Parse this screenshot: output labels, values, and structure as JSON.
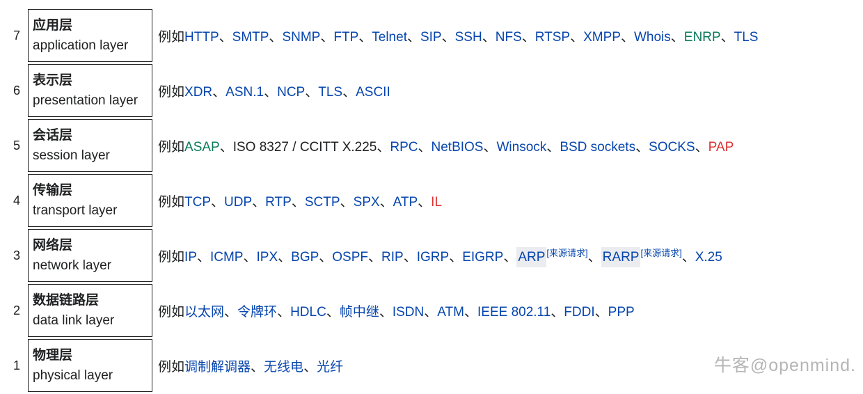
{
  "watermark": "牛客@openmind.",
  "prefix": "例如",
  "layers": [
    {
      "num": "7",
      "cn": "应用层",
      "en": "application layer",
      "items": [
        {
          "t": "HTTP",
          "s": "link"
        },
        {
          "t": "、",
          "s": "plain"
        },
        {
          "t": "SMTP",
          "s": "link"
        },
        {
          "t": "、",
          "s": "plain"
        },
        {
          "t": "SNMP",
          "s": "link"
        },
        {
          "t": "、",
          "s": "plain"
        },
        {
          "t": "FTP",
          "s": "link"
        },
        {
          "t": "、",
          "s": "plain"
        },
        {
          "t": "Telnet",
          "s": "link"
        },
        {
          "t": "、",
          "s": "plain"
        },
        {
          "t": "SIP",
          "s": "link"
        },
        {
          "t": "、",
          "s": "plain"
        },
        {
          "t": "SSH",
          "s": "link"
        },
        {
          "t": "、",
          "s": "plain"
        },
        {
          "t": "NFS",
          "s": "link"
        },
        {
          "t": "、",
          "s": "plain"
        },
        {
          "t": "RTSP",
          "s": "link"
        },
        {
          "t": "、",
          "s": "plain"
        },
        {
          "t": "XMPP",
          "s": "link"
        },
        {
          "t": "、",
          "s": "plain"
        },
        {
          "t": "Whois",
          "s": "link"
        },
        {
          "t": "、",
          "s": "plain"
        },
        {
          "t": "ENRP",
          "s": "ext"
        },
        {
          "t": "、",
          "s": "plain"
        },
        {
          "t": "TLS",
          "s": "link"
        }
      ]
    },
    {
      "num": "6",
      "cn": "表示层",
      "en": "presentation layer",
      "items": [
        {
          "t": "XDR",
          "s": "link"
        },
        {
          "t": "、",
          "s": "plain"
        },
        {
          "t": "ASN.1",
          "s": "link"
        },
        {
          "t": "、",
          "s": "plain"
        },
        {
          "t": "NCP",
          "s": "link"
        },
        {
          "t": "、",
          "s": "plain"
        },
        {
          "t": "TLS",
          "s": "link"
        },
        {
          "t": "、",
          "s": "plain"
        },
        {
          "t": "ASCII",
          "s": "link"
        }
      ]
    },
    {
      "num": "5",
      "cn": "会话层",
      "en": "session layer",
      "items": [
        {
          "t": "ASAP",
          "s": "ext"
        },
        {
          "t": "、ISO 8327 / CCITT X.225、",
          "s": "plain"
        },
        {
          "t": "RPC",
          "s": "link"
        },
        {
          "t": "、",
          "s": "plain"
        },
        {
          "t": "NetBIOS",
          "s": "link"
        },
        {
          "t": "、",
          "s": "plain"
        },
        {
          "t": "Winsock",
          "s": "link"
        },
        {
          "t": "、",
          "s": "plain"
        },
        {
          "t": "BSD sockets",
          "s": "link"
        },
        {
          "t": "、",
          "s": "plain"
        },
        {
          "t": "SOCKS",
          "s": "link"
        },
        {
          "t": "、",
          "s": "plain"
        },
        {
          "t": "PAP",
          "s": "new"
        }
      ]
    },
    {
      "num": "4",
      "cn": "传输层",
      "en": "transport layer",
      "items": [
        {
          "t": "TCP",
          "s": "link"
        },
        {
          "t": "、",
          "s": "plain"
        },
        {
          "t": "UDP",
          "s": "link"
        },
        {
          "t": "、",
          "s": "plain"
        },
        {
          "t": "RTP",
          "s": "link"
        },
        {
          "t": "、",
          "s": "plain"
        },
        {
          "t": "SCTP",
          "s": "link"
        },
        {
          "t": "、",
          "s": "plain"
        },
        {
          "t": "SPX",
          "s": "link"
        },
        {
          "t": "、",
          "s": "plain"
        },
        {
          "t": "ATP",
          "s": "link"
        },
        {
          "t": "、",
          "s": "plain"
        },
        {
          "t": "IL",
          "s": "new"
        }
      ]
    },
    {
      "num": "3",
      "cn": "网络层",
      "en": "network layer",
      "items": [
        {
          "t": "IP",
          "s": "link"
        },
        {
          "t": "、",
          "s": "plain"
        },
        {
          "t": "ICMP",
          "s": "link"
        },
        {
          "t": "、",
          "s": "plain"
        },
        {
          "t": "IPX",
          "s": "link"
        },
        {
          "t": "、",
          "s": "plain"
        },
        {
          "t": "BGP",
          "s": "link"
        },
        {
          "t": "、",
          "s": "plain"
        },
        {
          "t": "OSPF",
          "s": "link"
        },
        {
          "t": "、",
          "s": "plain"
        },
        {
          "t": "RIP",
          "s": "link"
        },
        {
          "t": "、",
          "s": "plain"
        },
        {
          "t": "IGRP",
          "s": "link"
        },
        {
          "t": "、",
          "s": "plain"
        },
        {
          "t": "EIGRP",
          "s": "link"
        },
        {
          "t": "、",
          "s": "plain"
        },
        {
          "t": "ARP",
          "s": "link hl"
        },
        {
          "t": "[来源请求]",
          "s": "link",
          "sup": true
        },
        {
          "t": "、",
          "s": "plain"
        },
        {
          "t": "RARP",
          "s": "link hl"
        },
        {
          "t": "[来源请求]",
          "s": "link",
          "sup": true
        },
        {
          "t": "、",
          "s": "plain"
        },
        {
          "t": "X.25",
          "s": "link"
        }
      ]
    },
    {
      "num": "2",
      "cn": "数据链路层",
      "en": "data link layer",
      "items": [
        {
          "t": "以太网",
          "s": "link"
        },
        {
          "t": "、",
          "s": "plain"
        },
        {
          "t": "令牌环",
          "s": "link"
        },
        {
          "t": "、",
          "s": "plain"
        },
        {
          "t": "HDLC",
          "s": "link"
        },
        {
          "t": "、",
          "s": "plain"
        },
        {
          "t": "帧中继",
          "s": "link"
        },
        {
          "t": "、",
          "s": "plain"
        },
        {
          "t": "ISDN",
          "s": "link"
        },
        {
          "t": "、",
          "s": "plain"
        },
        {
          "t": "ATM",
          "s": "link"
        },
        {
          "t": "、",
          "s": "plain"
        },
        {
          "t": "IEEE 802.11",
          "s": "link"
        },
        {
          "t": "、",
          "s": "plain"
        },
        {
          "t": "FDDI",
          "s": "link"
        },
        {
          "t": "、",
          "s": "plain"
        },
        {
          "t": "PPP",
          "s": "link"
        }
      ]
    },
    {
      "num": "1",
      "cn": "物理层",
      "en": "physical layer",
      "items": [
        {
          "t": "调制解调器",
          "s": "link"
        },
        {
          "t": "、",
          "s": "plain"
        },
        {
          "t": "无线电",
          "s": "link"
        },
        {
          "t": "、",
          "s": "plain"
        },
        {
          "t": "光纤",
          "s": "link"
        }
      ]
    }
  ]
}
